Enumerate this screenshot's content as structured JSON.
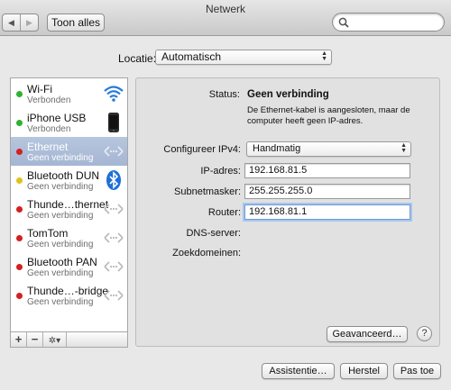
{
  "window": {
    "title": "Netwerk"
  },
  "toolbar": {
    "back_glyph": "◀",
    "forward_glyph": "▶",
    "show_all_label": "Toon alles",
    "search_placeholder": ""
  },
  "location": {
    "label": "Locatie:",
    "value": "Automatisch"
  },
  "services": [
    {
      "name": "Wi-Fi",
      "status": "Verbonden",
      "dot": "#2fb32f",
      "icon": "wifi-icon"
    },
    {
      "name": "iPhone USB",
      "status": "Verbonden",
      "dot": "#2fb32f",
      "icon": "iphone-icon"
    },
    {
      "name": "Ethernet",
      "status": "Geen verbinding",
      "dot": "#d42020",
      "icon": "ethernet-icon",
      "selected": true
    },
    {
      "name": "Bluetooth DUN",
      "status": "Geen verbinding",
      "dot": "#e2c21a",
      "icon": "bluetooth-icon"
    },
    {
      "name": "Thunde…thernet",
      "status": "Geen verbinding",
      "dot": "#d42020",
      "icon": "ethernet-icon"
    },
    {
      "name": "TomTom",
      "status": "Geen verbinding",
      "dot": "#d42020",
      "icon": "ethernet-icon"
    },
    {
      "name": "Bluetooth PAN",
      "status": "Geen verbinding",
      "dot": "#d42020",
      "icon": "ethernet-icon"
    },
    {
      "name": "Thunde…-bridge",
      "status": "Geen verbinding",
      "dot": "#d42020",
      "icon": "ethernet-icon"
    }
  ],
  "sidebar_footer": {
    "add": "+",
    "remove": "−",
    "gear": "✲▾"
  },
  "detail": {
    "status_label": "Status:",
    "status_value": "Geen verbinding",
    "status_desc": "De Ethernet-kabel is aangesloten, maar de computer heeft geen IP-adres.",
    "ipv4_label": "Configureer IPv4:",
    "ipv4_value": "Handmatig",
    "ip_label": "IP-adres:",
    "ip_value": "192.168.81.5",
    "subnet_label": "Subnetmasker:",
    "subnet_value": "255.255.255.0",
    "router_label": "Router:",
    "router_value": "192.168.81.1",
    "dns_label": "DNS-server:",
    "search_domains_label": "Zoekdomeinen:",
    "advanced_button": "Geavanceerd…",
    "help_button": "?"
  },
  "footer": {
    "assist_button": "Assistentie…",
    "revert_button": "Herstel",
    "apply_button": "Pas toe"
  }
}
